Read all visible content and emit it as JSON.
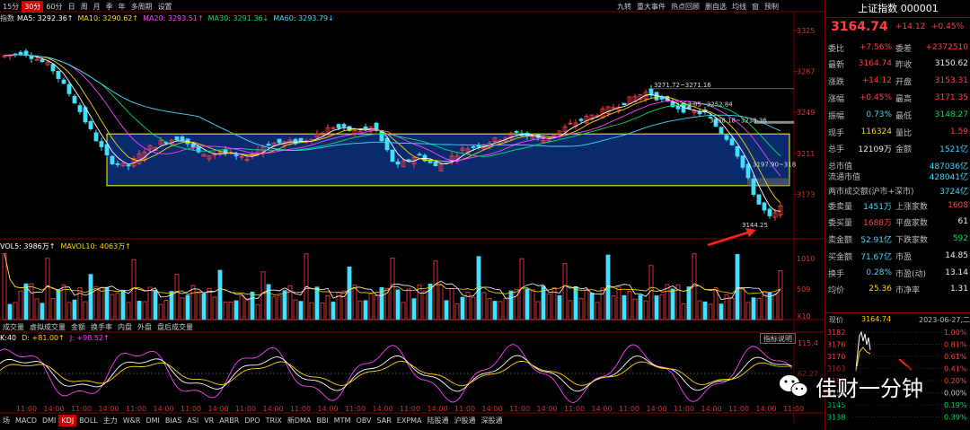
{
  "toolbar": {
    "periods": [
      "15分",
      "30分",
      "60分",
      "日",
      "周",
      "月",
      "季",
      "年",
      "多周期",
      "设置"
    ],
    "active_period": "30分",
    "right_tools": [
      "九转",
      "重大事件",
      "热点回顾",
      "删自选",
      "均线",
      "窗",
      "预制"
    ]
  },
  "ma_legend": {
    "prefix": "指数",
    "items": [
      {
        "label": "MA5: 3292.36↑",
        "color": "#ffffff"
      },
      {
        "label": "MA10: 3290.62↑",
        "color": "#ffd400"
      },
      {
        "label": "MA20: 3293.51↑",
        "color": "#ff40ff"
      },
      {
        "label": "MA30: 3291.36↓",
        "color": "#00e060"
      },
      {
        "label": "MA60: 3293.79↓",
        "color": "#40d8ff"
      }
    ]
  },
  "price_axis": [
    "3325",
    "3287",
    "3249",
    "3211",
    "3173"
  ],
  "price_annotations": {
    "high": "3271.72~3271.16",
    "mid1": "3253.05~3252.84",
    "mid2": "3238.18~3238.36",
    "mid3": "3197.90~318",
    "low": "3144.25"
  },
  "vol_legend": {
    "vol5": "VOL5: 3986万↑",
    "mavol10": "MAVOL10: 4063万↑"
  },
  "vol_axis": [
    "1010",
    "509",
    "X10"
  ],
  "vol_tabs": [
    "成交量",
    "虚拟成交量",
    "金额",
    "换手率",
    "内盘",
    "外盘",
    "盘后成交量"
  ],
  "kdj_legend": {
    "prefix": "K:40",
    "d": "D: +81.00↑",
    "j": "J: +98.52↑"
  },
  "kdj_axis": [
    "115.4",
    "62.27"
  ],
  "kdj_help": "指标说明",
  "time_labels": [
    "11:00",
    "14:00",
    "11:00",
    "14:00",
    "11:00",
    "14:00",
    "11:00",
    "14:00",
    "11:00",
    "14:00",
    "11:00",
    "14:00",
    "11:00",
    "14:00",
    "11:00",
    "14:00",
    "11:00",
    "14:00",
    "11:00",
    "14:00",
    "11:00",
    "14:00",
    "11:00",
    "14:00",
    "11:00",
    "14:00",
    "11:00",
    "14:00",
    "11:00"
  ],
  "indicator_tabs": [
    "场",
    "MACD",
    "DMI",
    "KDJ",
    "BOLL",
    "主力",
    "W&R",
    "DMI",
    "BIAS",
    "ASI",
    "VR",
    "ARBR",
    "DPO",
    "TRIX",
    "新DMA",
    "BBI",
    "MTM",
    "OBV",
    "SAR",
    "EXPMA",
    "陆股通",
    "沪股通",
    "深股通"
  ],
  "active_indicator": "KDJ",
  "quote": {
    "title": "上证指数 000001",
    "price": "3164.74",
    "change": "+14.12",
    "pct": "+0.45%",
    "rows": [
      {
        "l1": "委比",
        "v1": "+7.56%",
        "c1": "red",
        "l2": "委差",
        "v2": "+2372510",
        "c2": "red"
      },
      {
        "l1": "最新",
        "v1": "3164.74",
        "c1": "red",
        "l2": "昨收",
        "v2": "3150.62",
        "c2": "white"
      },
      {
        "l1": "涨跌",
        "v1": "+14.12",
        "c1": "red",
        "l2": "开盘",
        "v2": "3153.31",
        "c2": "red"
      },
      {
        "l1": "涨幅",
        "v1": "+0.45%",
        "c1": "red",
        "l2": "最高",
        "v2": "3171.35",
        "c2": "red"
      },
      {
        "l1": "振幅",
        "v1": "0.73%",
        "c1": "cyan",
        "l2": "最低",
        "v2": "3148.27",
        "c2": "green"
      },
      {
        "l1": "现手",
        "v1": "116324",
        "c1": "yel",
        "l2": "量比",
        "v2": "1.59",
        "c2": "red"
      },
      {
        "l1": "总手",
        "v1": "12109万",
        "c1": "white",
        "l2": "金额",
        "v2": "1521亿",
        "c2": "cyan"
      },
      {
        "l1": "总市值",
        "v1": "",
        "c1": "white",
        "l2": "",
        "v2": "487036亿",
        "c2": "cyan"
      },
      {
        "l1": "流通市值",
        "v1": "",
        "c1": "white",
        "l2": "",
        "v2": "428041亿",
        "c2": "cyan"
      },
      {
        "l1": "两市成交额(沪市+深市)",
        "v1": "",
        "c1": "white",
        "l2": "",
        "v2": "3724亿",
        "c2": "cyan"
      },
      {
        "l1": "委卖量",
        "v1": "1451万",
        "c1": "cyan",
        "l2": "上涨家数",
        "v2": "1608",
        "c2": "red"
      },
      {
        "l1": "委买量",
        "v1": "1688万",
        "c1": "red",
        "l2": "平盘家数",
        "v2": "61",
        "c2": "white"
      },
      {
        "l1": "卖金额",
        "v1": "52.91亿",
        "c1": "cyan",
        "l2": "下跌家数",
        "v2": "592",
        "c2": "green"
      },
      {
        "l1": "买金额",
        "v1": "71.67亿",
        "c1": "cyan",
        "l2": "市盈",
        "v2": "14.85",
        "c2": "white"
      },
      {
        "l1": "换手",
        "v1": "0.28%",
        "c1": "cyan",
        "l2": "市盈(动)",
        "v2": "13.14",
        "c2": "white"
      },
      {
        "l1": "均价",
        "v1": "25.36",
        "c1": "yel",
        "l2": "市净率",
        "v2": "1.31",
        "c2": "white"
      }
    ],
    "spark_header": {
      "label": "现价",
      "price": "3164.74",
      "date": "2023-06-27,二"
    },
    "spark_left": [
      "3182",
      "3176",
      "3170",
      "3163",
      "3157",
      "3151",
      "3145",
      "3138"
    ],
    "spark_right": [
      "1.00%",
      "0.81%",
      "0.61%",
      "0.41%",
      "0.20%",
      "0.00%",
      "0.19%",
      "0.39%"
    ]
  },
  "watermark": "佳财一分钟",
  "colors": {
    "up": "#ff4040",
    "down": "#40e0ff",
    "box_fill": "#0a2a6e",
    "box_border": "#ffff00",
    "arrow": "#ff2020"
  }
}
